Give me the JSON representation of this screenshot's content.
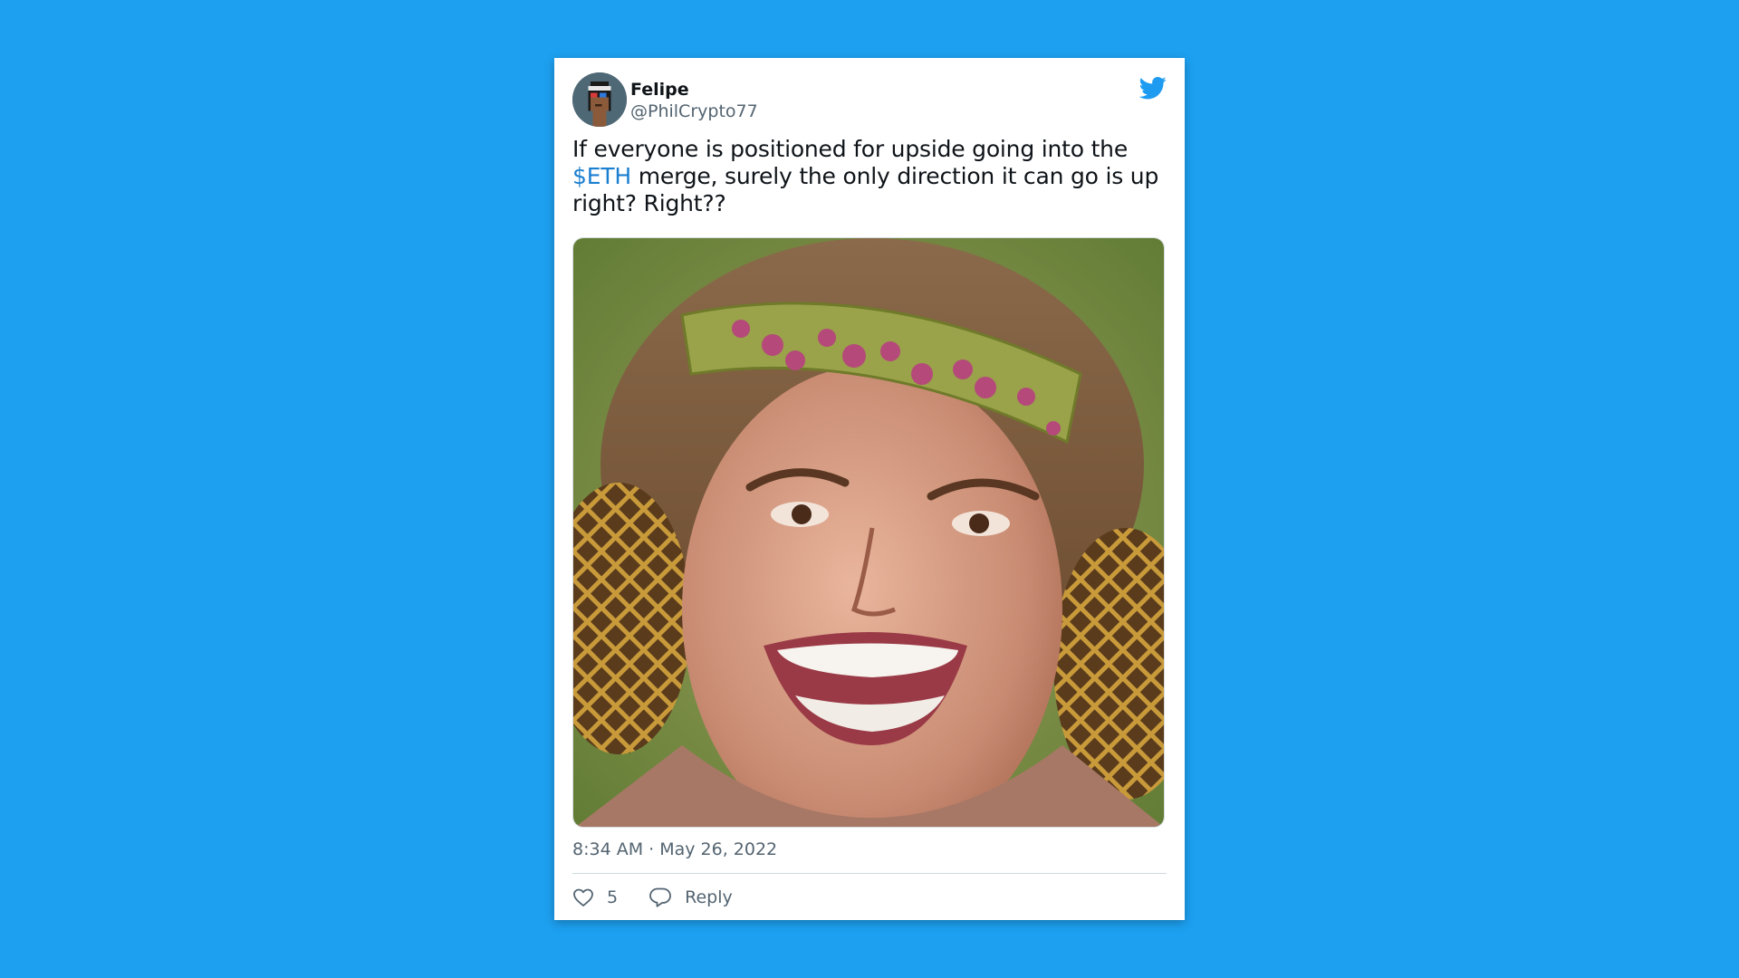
{
  "tweet": {
    "author_name": "Felipe",
    "author_handle": "@PhilCrypto77",
    "text_before": "If everyone is positioned for upside going into the ",
    "cashtag": "$ETH",
    "text_after": " merge, surely the only direction it can go is up right? Right??",
    "timestamp": "8:34 AM · May 26, 2022",
    "like_count": "5",
    "reply_label": "Reply"
  },
  "icons": {
    "brand": "twitter-bird-icon",
    "like": "heart-icon",
    "reply": "speech-bubble-icon"
  },
  "colors": {
    "background": "#1da0f0",
    "card": "#ffffff",
    "text": "#0f1419",
    "secondary_text": "#536471",
    "link": "#1b7fd0",
    "twitter_blue": "#1d9bf0"
  }
}
